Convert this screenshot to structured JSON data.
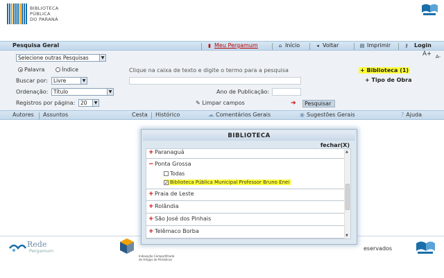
{
  "header": {
    "logo_lines": [
      "BIBLIOTECA",
      "PÚBLICA",
      "DO PARANÁ"
    ],
    "bar_colors": [
      "#1b6ea8",
      "#1b6ea8",
      "#f2a100",
      "#1b6ea8",
      "#1b6ea8",
      "#1b6ea8",
      "#f2a100",
      "#1b6ea8",
      "#1b6ea8",
      "#1b6ea8"
    ]
  },
  "topbar": {
    "title": "Pesquisa Geral",
    "meu_pergamum": "Meu Pergamum",
    "inicio": "Início",
    "voltar": "Voltar",
    "imprimir": "Imprimir",
    "login": "Login",
    "font_plus": "A+",
    "font_minus": "A-"
  },
  "form": {
    "outras_pesquisas": "Selecione outras Pesquisas",
    "radio_palavra": "Palavra",
    "radio_indice": "Índice",
    "instruction": "Clique na caixa de texto e digite o termo para a pesquisa",
    "buscar_por_label": "Buscar por:",
    "buscar_por_value": "Livre",
    "ordenacao_label": "Ordenação:",
    "ordenacao_value": "Título",
    "registros_label": "Registros por página:",
    "registros_value": "20",
    "ano_label": "Ano de Publicação:",
    "limpar": "Limpar campos",
    "pesquisar": "Pesquisar",
    "biblioteca_selected": "+ Biblioteca (1)",
    "tipo_obra": "+ Tipo de Obra"
  },
  "tabs": {
    "autores": "Autores",
    "assuntos": "Assuntos",
    "cesta": "Cesta",
    "historico": "Histórico",
    "comentarios": "Comentários Gerais",
    "sugestoes": "Sugestões Gerais",
    "ajuda": "Ajuda"
  },
  "popup": {
    "title": "BIBLIOTECA",
    "close": "fechar(X)",
    "items": {
      "paranagua": "Paranaguá",
      "ponta_grossa": "Ponta Grossa",
      "todas": "Todas",
      "biblioteca_pg": "Biblioteca Pública Municipal Professor Bruno Enei",
      "praia": "Praia de Leste",
      "rolandia": "Rolândia",
      "sjp": "São José dos Pinhais",
      "telemaco": "Telêmaco Borba"
    }
  },
  "footer": {
    "rede": "Rede",
    "pergamum": "Pergamum",
    "ibict_line1": "Indexação Compartilhada",
    "ibict_line2": "de Artigos de Periódicos",
    "direitos": "eservados"
  }
}
